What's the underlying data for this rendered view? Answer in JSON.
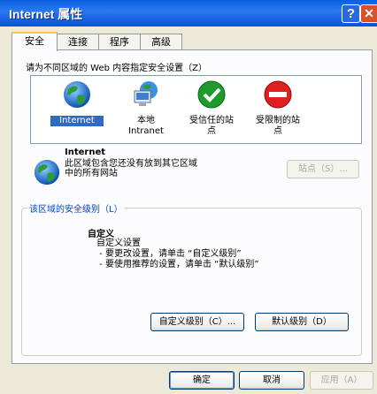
{
  "window": {
    "title": "Internet 属性"
  },
  "tabs": [
    "安全",
    "连接",
    "程序",
    "高级"
  ],
  "zone_prompt": "请为不同区域的 Web 内容指定安全设置（Z）",
  "zones": [
    {
      "label": "Internet",
      "icon": "globe-icon",
      "selected": true
    },
    {
      "label": "本地\nIntranet",
      "icon": "intranet-icon"
    },
    {
      "label": "受信任的站\n点",
      "icon": "check-icon"
    },
    {
      "label": "受限制的站\n点",
      "icon": "restricted-icon"
    }
  ],
  "zone_info": {
    "title": "Internet",
    "description": "此区域包含您还没有放到其它区域\n中的所有网站",
    "sites_button": "站点（S）..."
  },
  "security_level": {
    "group_label": "该区域的安全级别（L）",
    "title": "自定义",
    "description": "自定义设置\n - 要更改设置，请单击 “自定义级别”\n - 要使用推荐的设置，请单击 “默认级别”",
    "custom_button": "自定义级别（C）...",
    "default_button": "默认级别（D）"
  },
  "footer": {
    "ok": "确定",
    "cancel": "取消",
    "apply": "应用（A）"
  },
  "colors": {
    "titlebar": "#0a5fe0",
    "selection": "#316ac5",
    "tab_highlight": "#ffc83c"
  }
}
